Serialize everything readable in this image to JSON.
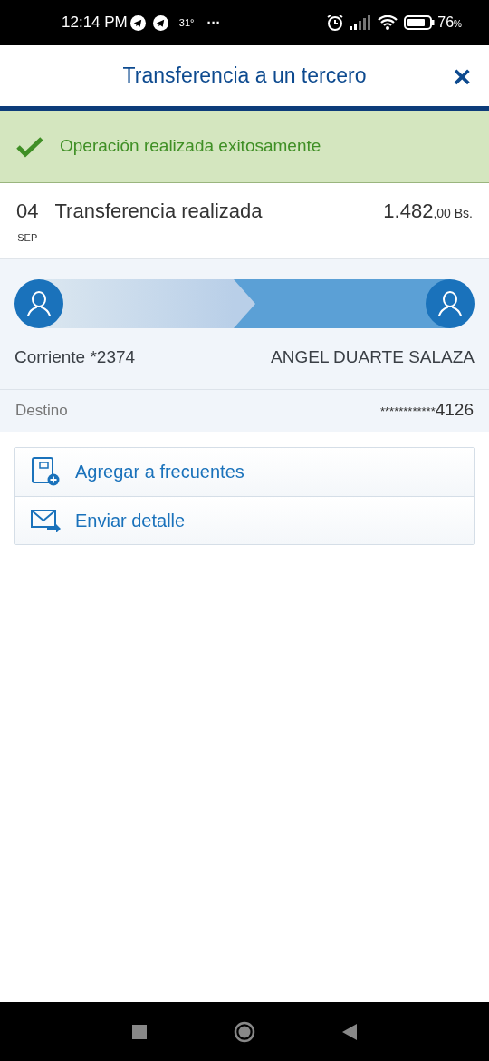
{
  "status_bar": {
    "time": "12:14 PM",
    "temperature": "31°",
    "more": "···",
    "battery": "76",
    "battery_unit": "%"
  },
  "header": {
    "title": "Transferencia a un tercero",
    "close": "×"
  },
  "banner": {
    "message": "Operación realizada exitosamente"
  },
  "transaction": {
    "day": "04",
    "month": "SEP",
    "description": "Transferencia realizada",
    "amount_integer": "1.482",
    "amount_decimals": ",00 Bs."
  },
  "transfer": {
    "from": "Corriente *2374",
    "to": "ANGEL DUARTE SALAZA"
  },
  "destination": {
    "label": "Destino",
    "value_mask": "************",
    "value_digits": "4126"
  },
  "actions": [
    {
      "kind": "add",
      "label": "Agregar a frecuentes"
    },
    {
      "kind": "send",
      "label": "Enviar detalle"
    }
  ]
}
